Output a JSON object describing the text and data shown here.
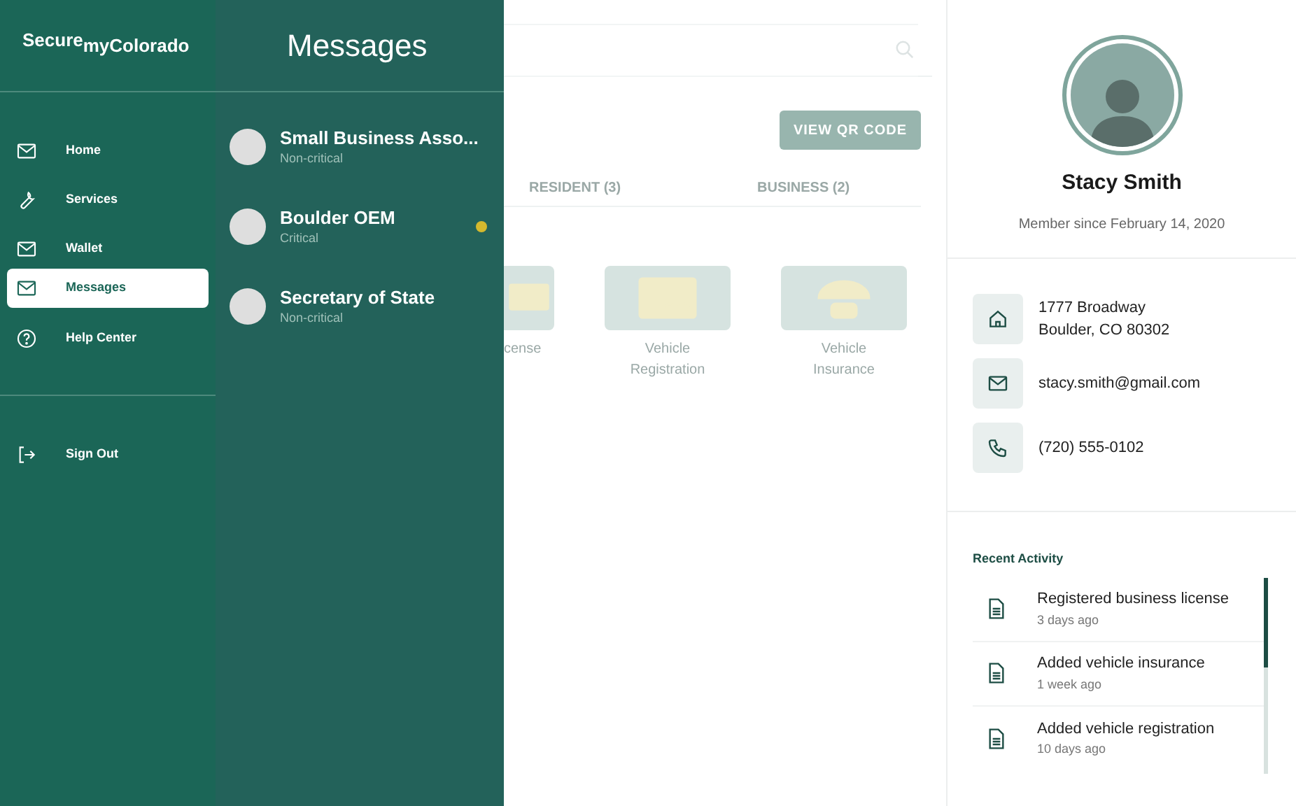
{
  "sidebar": {
    "logo": {
      "raised": "Secure",
      "main": "myColorado"
    },
    "items": [
      {
        "label": "Home",
        "selected": false
      },
      {
        "label": "Services",
        "selected": false
      },
      {
        "label": "Wallet",
        "selected": false
      },
      {
        "label": "Messages",
        "selected": true
      },
      {
        "label": "Help Center",
        "selected": false
      }
    ],
    "sign_out": "Sign Out"
  },
  "messages": {
    "title": "Messages",
    "items": [
      {
        "sender": "Small Business Asso...",
        "priority": "Non-critical",
        "unread": false
      },
      {
        "sender": "Boulder OEM",
        "priority": "Critical",
        "unread": true
      },
      {
        "sender": "Secretary of State",
        "priority": "Non-critical",
        "unread": false
      }
    ]
  },
  "main": {
    "qr_button": "VIEW QR CODE",
    "tabs": [
      {
        "label": "RESIDENT (3)",
        "selected": false
      },
      {
        "label": "BUSINESS (2)",
        "selected": false
      }
    ],
    "cards": [
      {
        "label": "cense"
      },
      {
        "label": "Vehicle Registration"
      },
      {
        "label": "Vehicle Insurance"
      }
    ]
  },
  "profile": {
    "name": "Stacy Smith",
    "member_since": "Member since February 14, 2020",
    "contacts": [
      {
        "lines": [
          "1777 Broadway",
          "Boulder, CO 80302"
        ]
      },
      {
        "lines": [
          "stacy.smith@gmail.com"
        ]
      },
      {
        "lines": [
          "(720) 555-0102"
        ]
      }
    ],
    "recent_title": "Recent Activity",
    "activity": [
      {
        "title": "Registered business license",
        "time": "3 days ago"
      },
      {
        "title": "Added vehicle insurance",
        "time": "1 week ago"
      },
      {
        "title": "Added vehicle registration",
        "time": "10 days ago"
      }
    ]
  }
}
